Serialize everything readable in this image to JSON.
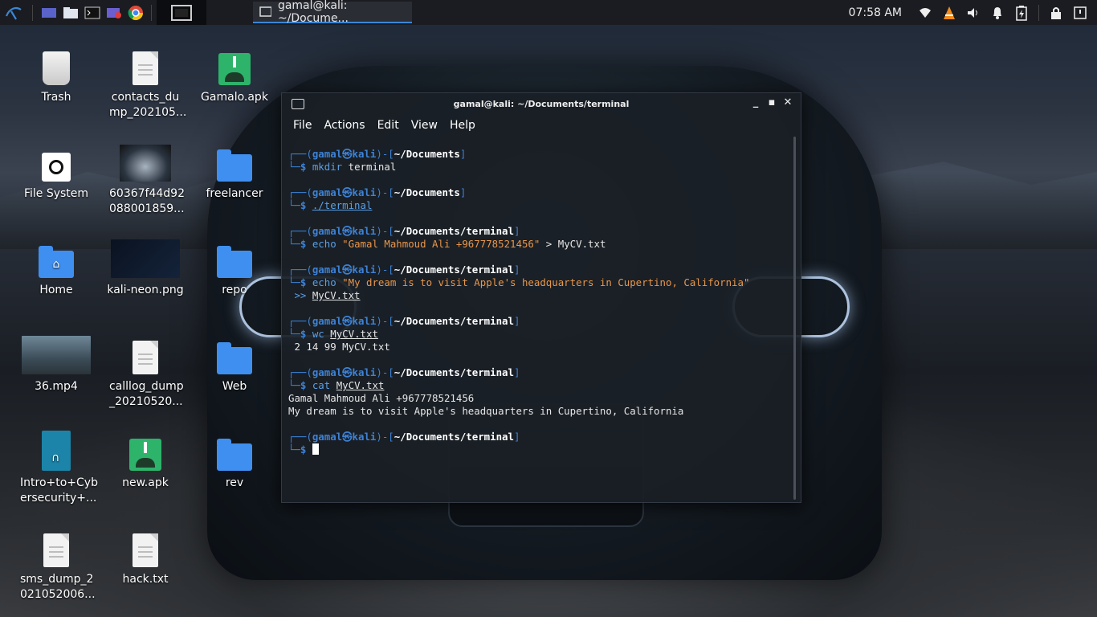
{
  "panel": {
    "task_title": "gamal@kali: ~/Docume...",
    "clock": "07:58 AM"
  },
  "desktop": [
    {
      "label": "Trash",
      "kind": "trash"
    },
    {
      "label": "contacts_du mp_202105...",
      "kind": "doc"
    },
    {
      "label": "Gamalo.apk",
      "kind": "apk"
    },
    {
      "label": "File System",
      "kind": "fs"
    },
    {
      "label": "60367f44d92 088001859...",
      "kind": "thumb-car"
    },
    {
      "label": "freelancer",
      "kind": "folder"
    },
    {
      "label": "Home",
      "kind": "folder-home"
    },
    {
      "label": "kali-neon.png",
      "kind": "thumb-kali"
    },
    {
      "label": "repo",
      "kind": "folder"
    },
    {
      "label": "36.mp4",
      "kind": "thumb-video"
    },
    {
      "label": "calllog_dump _20210520...",
      "kind": "doc"
    },
    {
      "label": "Web",
      "kind": "folder"
    },
    {
      "label": "Intro+to+Cyb ersecurity+...",
      "kind": "book"
    },
    {
      "label": "new.apk",
      "kind": "apk"
    },
    {
      "label": "rev",
      "kind": "folder"
    },
    {
      "label": "sms_dump_2 021052006...",
      "kind": "doc"
    },
    {
      "label": "hack.txt",
      "kind": "doc"
    }
  ],
  "terminal": {
    "title": "gamal@kali: ~/Documents/terminal",
    "menu": [
      "File",
      "Actions",
      "Edit",
      "View",
      "Help"
    ],
    "user": "gamal",
    "host": "kali",
    "at_symbol": "㉿",
    "blocks": [
      {
        "path": "~/Documents",
        "cmd": "mkdir",
        "args": " terminal",
        "args_underline": false,
        "output": []
      },
      {
        "path": "~/Documents",
        "cmd": "",
        "args": "./terminal",
        "args_underline": true,
        "output": []
      },
      {
        "path": "~/Documents/terminal",
        "cmd": "echo",
        "str": "\"Gamal Mahmoud Ali +967778521456\"",
        "redir": " > ",
        "file": "MyCV.txt",
        "output": []
      },
      {
        "path": "~/Documents/terminal",
        "cmd": "echo",
        "str": "\"My dream is to visit Apple's headquarters in Cupertino, California\"",
        "cont_redir": " >> ",
        "cont_file": "MyCV.txt",
        "output": []
      },
      {
        "path": "~/Documents/terminal",
        "cmd": "wc",
        "file_u": "MyCV.txt",
        "output": [
          " 2 14 99 MyCV.txt"
        ]
      },
      {
        "path": "~/Documents/terminal",
        "cmd": "cat",
        "file_u": "MyCV.txt",
        "output": [
          "Gamal Mahmoud Ali +967778521456",
          "My dream is to visit Apple's headquarters in Cupertino, California"
        ]
      },
      {
        "path": "~/Documents/terminal",
        "cmd": "",
        "prompt_only": true
      }
    ]
  },
  "icons": {
    "tray": [
      "wifi-icon",
      "vlc-icon",
      "volume-icon",
      "bell-icon",
      "battery-icon",
      "lock-icon",
      "power-icon"
    ]
  }
}
